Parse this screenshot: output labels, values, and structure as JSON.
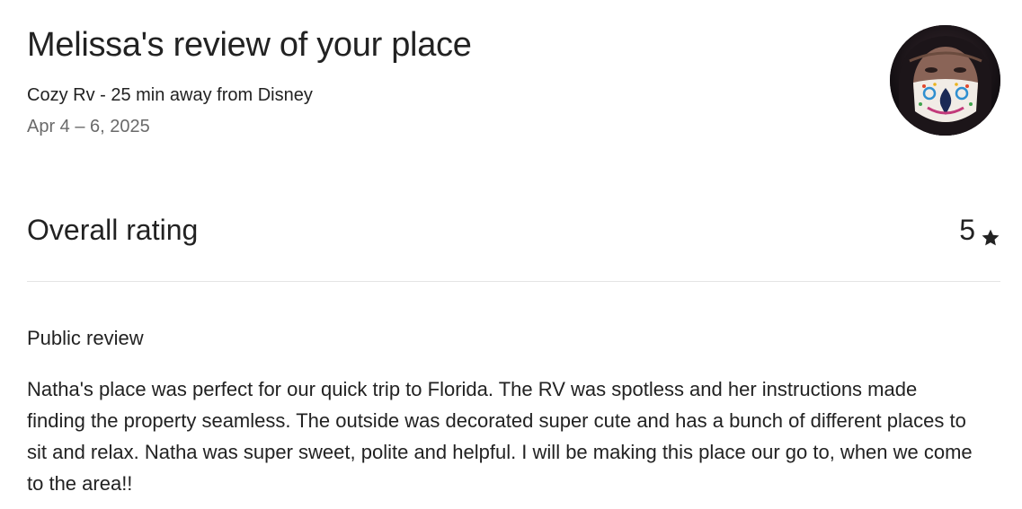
{
  "header": {
    "title": "Melissa's review of your place",
    "listing_name": "Cozy Rv - 25 min away from Disney",
    "stay_dates": "Apr 4 – 6, 2025",
    "avatar_icon": "guest-avatar-photo"
  },
  "rating": {
    "label": "Overall rating",
    "value": "5",
    "icon": "star-icon"
  },
  "review": {
    "heading": "Public review",
    "text": "Natha's place was perfect for our quick trip to Florida. The RV was spotless and her instructions made finding the property seamless. The outside was decorated super cute and has a bunch of different places to sit and relax. Natha was super sweet, polite and helpful. I will be making this place our go to, when we come to the area!!"
  },
  "colors": {
    "text_primary": "#222222",
    "text_secondary": "#6a6a6a",
    "divider": "#e4e4e4"
  }
}
